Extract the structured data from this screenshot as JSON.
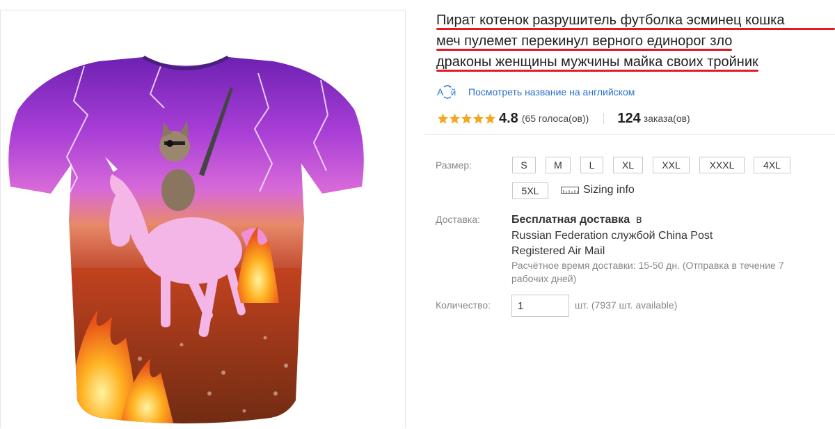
{
  "product": {
    "title_lines": [
      "Пират котенок разрушитель футболка эсминец кошка",
      "меч пулемет перекинул верного единорог зло",
      "драконы женщины мужчины майка своих тройник"
    ],
    "translate_link": "Посмотреть название на английском",
    "translate_icon": "translate-icon",
    "image_icon": "t-shirt-photo"
  },
  "rating": {
    "stars_filled": 5,
    "star_color": "#f5a623",
    "value": "4.8",
    "votes": "(65 голоса(ов))",
    "orders_count": "124",
    "orders_label": "заказа(ов)"
  },
  "size": {
    "label": "Размер:",
    "options": [
      "S",
      "M",
      "L",
      "XL",
      "XXL",
      "XXXL",
      "4XL",
      "5XL"
    ],
    "sizing_info": "Sizing info"
  },
  "shipping": {
    "label": "Доставка:",
    "free_label": "Бесплатная доставка",
    "to_prefix": "в",
    "destination": "Russian Federation службой China Post Registered Air Mail",
    "estimate": "Расчётное время доставки: 15-50 дн. (Отправка в течение 7 рабочих дней)"
  },
  "quantity": {
    "label": "Количество:",
    "value": "1",
    "unit_text": "шт. (7937 шт. available)"
  },
  "colors": {
    "link": "#2a72c7",
    "title_underline": "#e01b24"
  }
}
